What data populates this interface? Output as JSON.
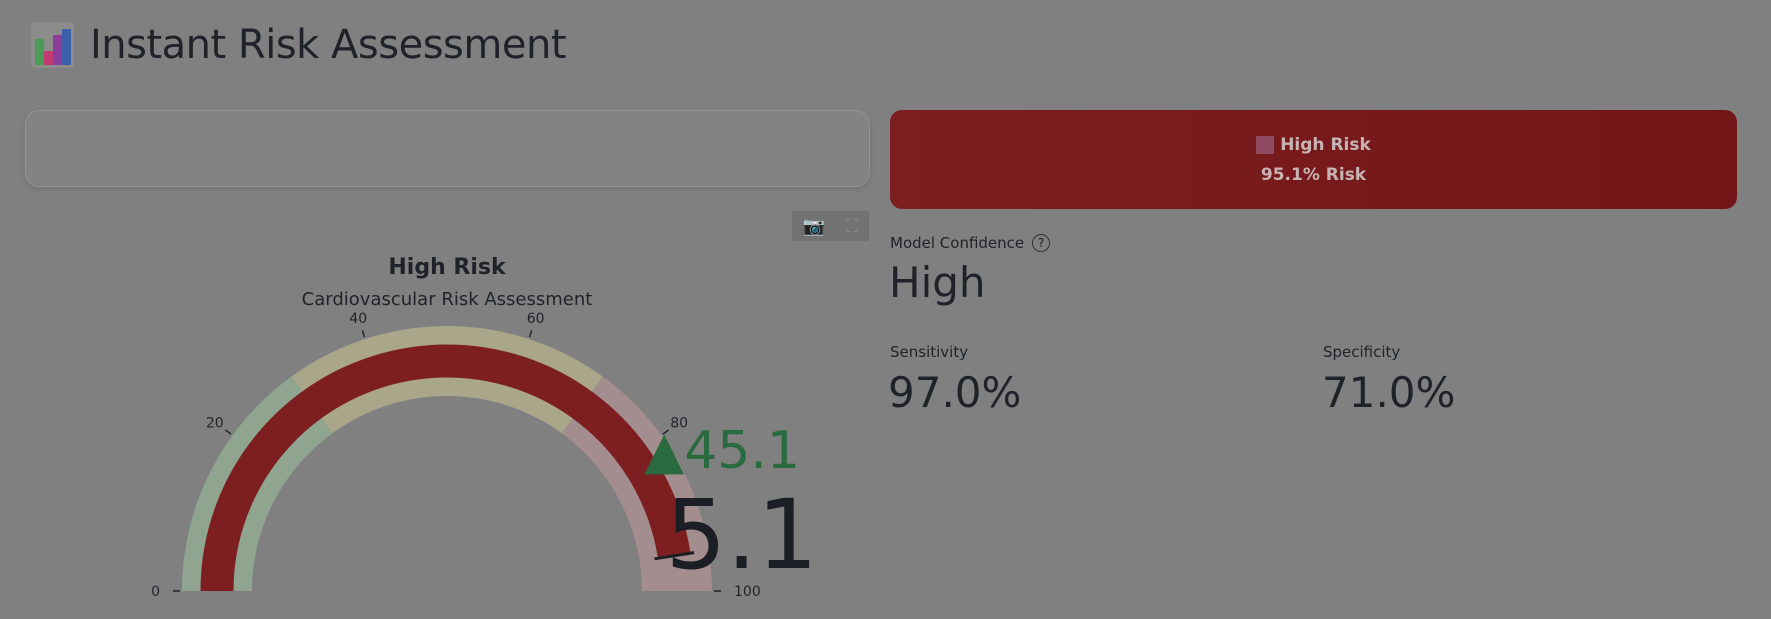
{
  "header": {
    "title": "Instant Risk Assessment",
    "icon": "bar-chart-icon"
  },
  "banner": {
    "label": "High Risk",
    "risk_text": "95.1% Risk",
    "color": "#7d1f21"
  },
  "gauge": {
    "title": "High Risk",
    "subtitle": "Cardiovascular Risk Assessment",
    "value": 95.1,
    "value_text": "5.1",
    "delta_text": "▲45.1",
    "min": 0,
    "max": 100,
    "ticks": [
      "0",
      "20",
      "40",
      "60",
      "80",
      "100"
    ],
    "tick_values": [
      0,
      20,
      40,
      60,
      80,
      100
    ],
    "bands": [
      {
        "from": 0,
        "to": 30,
        "color": "#8fa590"
      },
      {
        "from": 30,
        "to": 70,
        "color": "#aaa68a"
      },
      {
        "from": 70,
        "to": 100,
        "color": "#a48d8e"
      }
    ],
    "bar_color": "#7d1f21"
  },
  "metrics": {
    "confidence": {
      "label": "Model Confidence",
      "value": "High"
    },
    "sensitivity": {
      "label": "Sensitivity",
      "value": "97.0%"
    },
    "specificity": {
      "label": "Specificity",
      "value": "71.0%"
    }
  },
  "toolbar": {
    "camera": "camera-icon",
    "fullscreen": "fullscreen-icon"
  }
}
